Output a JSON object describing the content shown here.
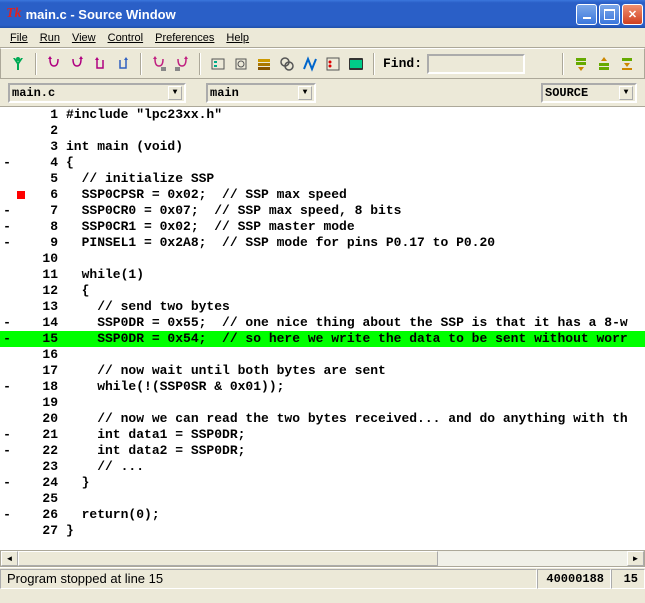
{
  "window": {
    "title": "main.c - Source Window"
  },
  "menu": {
    "items": [
      "File",
      "Run",
      "View",
      "Control",
      "Preferences",
      "Help"
    ]
  },
  "toolbar": {
    "find_label": "Find:",
    "find_value": ""
  },
  "selectors": {
    "file": "main.c",
    "func": "main",
    "mode": "SOURCE"
  },
  "code": {
    "lines": [
      {
        "n": 1,
        "mark": "",
        "bp": false,
        "text": "#include \"lpc23xx.h\"",
        "hl": false
      },
      {
        "n": 2,
        "mark": "",
        "bp": false,
        "text": "",
        "hl": false
      },
      {
        "n": 3,
        "mark": "",
        "bp": false,
        "text": "int main (void)",
        "hl": false
      },
      {
        "n": 4,
        "mark": "-",
        "bp": false,
        "text": "{",
        "hl": false
      },
      {
        "n": 5,
        "mark": "",
        "bp": false,
        "text": "  // initialize SSP",
        "hl": false
      },
      {
        "n": 6,
        "mark": "",
        "bp": true,
        "text": "  SSP0CPSR = 0x02;  // SSP max speed",
        "hl": false
      },
      {
        "n": 7,
        "mark": "-",
        "bp": false,
        "text": "  SSP0CR0 = 0x07;  // SSP max speed, 8 bits",
        "hl": false
      },
      {
        "n": 8,
        "mark": "-",
        "bp": false,
        "text": "  SSP0CR1 = 0x02;  // SSP master mode",
        "hl": false
      },
      {
        "n": 9,
        "mark": "-",
        "bp": false,
        "text": "  PINSEL1 = 0x2A8;  // SSP mode for pins P0.17 to P0.20",
        "hl": false
      },
      {
        "n": 10,
        "mark": "",
        "bp": false,
        "text": "",
        "hl": false
      },
      {
        "n": 11,
        "mark": "",
        "bp": false,
        "text": "  while(1)",
        "hl": false
      },
      {
        "n": 12,
        "mark": "",
        "bp": false,
        "text": "  {",
        "hl": false
      },
      {
        "n": 13,
        "mark": "",
        "bp": false,
        "text": "    // send two bytes",
        "hl": false
      },
      {
        "n": 14,
        "mark": "-",
        "bp": false,
        "text": "    SSP0DR = 0x55;  // one nice thing about the SSP is that it has a 8-w",
        "hl": false
      },
      {
        "n": 15,
        "mark": "-",
        "bp": false,
        "text": "    SSP0DR = 0x54;  // so here we write the data to be sent without worr",
        "hl": true
      },
      {
        "n": 16,
        "mark": "",
        "bp": false,
        "text": "",
        "hl": false
      },
      {
        "n": 17,
        "mark": "",
        "bp": false,
        "text": "    // now wait until both bytes are sent",
        "hl": false
      },
      {
        "n": 18,
        "mark": "-",
        "bp": false,
        "text": "    while(!(SSP0SR & 0x01));",
        "hl": false
      },
      {
        "n": 19,
        "mark": "",
        "bp": false,
        "text": "",
        "hl": false
      },
      {
        "n": 20,
        "mark": "",
        "bp": false,
        "text": "    // now we can read the two bytes received... and do anything with th",
        "hl": false
      },
      {
        "n": 21,
        "mark": "-",
        "bp": false,
        "text": "    int data1 = SSP0DR;",
        "hl": false
      },
      {
        "n": 22,
        "mark": "-",
        "bp": false,
        "text": "    int data2 = SSP0DR;",
        "hl": false
      },
      {
        "n": 23,
        "mark": "",
        "bp": false,
        "text": "    // ...",
        "hl": false
      },
      {
        "n": 24,
        "mark": "-",
        "bp": false,
        "text": "  }",
        "hl": false
      },
      {
        "n": 25,
        "mark": "",
        "bp": false,
        "text": "",
        "hl": false
      },
      {
        "n": 26,
        "mark": "-",
        "bp": false,
        "text": "  return(0);",
        "hl": false
      },
      {
        "n": 27,
        "mark": "",
        "bp": false,
        "text": "}",
        "hl": false
      }
    ]
  },
  "status": {
    "message": "Program stopped at line 15",
    "address": "40000188",
    "line": "15"
  }
}
